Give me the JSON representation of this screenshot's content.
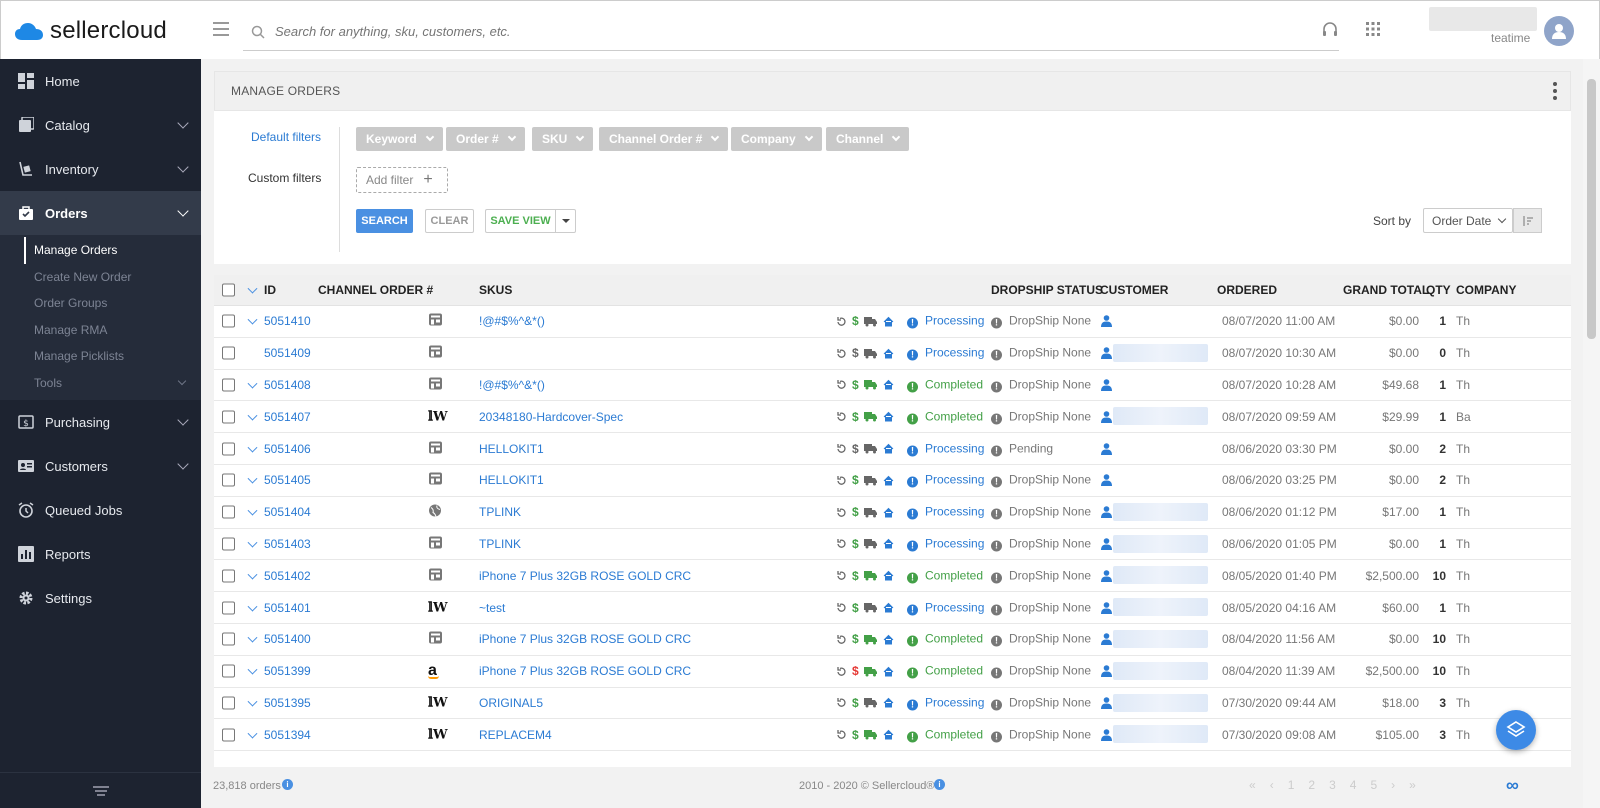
{
  "app": {
    "brand": "sellercloud",
    "brand_color": "#1e88e5"
  },
  "header": {
    "search_placeholder": "Search for anything, sku, customers, etc.",
    "username": "teatime",
    "icons": [
      "headset-icon",
      "apps-grid-icon",
      "avatar-icon"
    ]
  },
  "sidebar": {
    "items": [
      {
        "label": "Home",
        "icon": "dashboard-icon"
      },
      {
        "label": "Catalog",
        "icon": "catalog-icon"
      },
      {
        "label": "Inventory",
        "icon": "inventory-icon"
      },
      {
        "label": "Orders",
        "icon": "orders-icon"
      },
      {
        "label": "Purchasing",
        "icon": "purchasing-icon"
      },
      {
        "label": "Customers",
        "icon": "customers-icon"
      },
      {
        "label": "Queued Jobs",
        "icon": "clock-icon"
      },
      {
        "label": "Reports",
        "icon": "reports-icon"
      },
      {
        "label": "Settings",
        "icon": "gear-icon"
      }
    ],
    "orders_sub": [
      "Manage Orders",
      "Create New Order",
      "Order Groups",
      "Manage RMA",
      "Manage Picklists",
      "Tools"
    ]
  },
  "panel": {
    "title": "MANAGE ORDERS",
    "default_filters_label": "Default filters",
    "custom_filters_label": "Custom filters",
    "chips": [
      "Keyword",
      "Order #",
      "SKU",
      "Channel Order #",
      "Company",
      "Channel"
    ],
    "add_filter": "Add filter",
    "search_btn": "SEARCH",
    "clear_btn": "CLEAR",
    "save_view_btn": "SAVE VIEW",
    "sort_by_label": "Sort by",
    "sort_value": "Order Date"
  },
  "table": {
    "headers": {
      "id": "ID",
      "channel_order": "CHANNEL ORDER #",
      "skus": "SKUS",
      "dropship": "DROPSHIP STATUS",
      "customer": "CUSTOMER",
      "ordered": "ORDERED",
      "grand_total": "GRAND TOTAL",
      "qty": "QTY",
      "company": "COMPANY"
    },
    "rows": [
      {
        "id": "5051410",
        "channel": "store",
        "sku": "!@#$%^&*()",
        "status": "Processing",
        "dropship": "DropShip None",
        "ordered": "08/07/2020 11:00 AM",
        "total": "$0.00",
        "qty": "1",
        "company": "Th",
        "chev": true,
        "blur": false,
        "dollar": "green",
        "truck": "grey"
      },
      {
        "id": "5051409",
        "channel": "store",
        "sku": "",
        "status": "Processing",
        "dropship": "DropShip None",
        "ordered": "08/07/2020 10:30 AM",
        "total": "$0.00",
        "qty": "0",
        "company": "Th",
        "chev": false,
        "blur": true,
        "dollar": "grey",
        "truck": "grey"
      },
      {
        "id": "5051408",
        "channel": "store",
        "sku": "!@#$%^&*()",
        "status": "Completed",
        "dropship": "DropShip None",
        "ordered": "08/07/2020 10:28 AM",
        "total": "$49.68",
        "qty": "1",
        "company": "Th",
        "chev": true,
        "blur": false,
        "dollar": "green",
        "truck": "green"
      },
      {
        "id": "5051407",
        "channel": "bw",
        "sku": "20348180-Hardcover-Spec",
        "status": "Completed",
        "dropship": "DropShip None",
        "ordered": "08/07/2020 09:59 AM",
        "total": "$29.99",
        "qty": "1",
        "company": "Ba",
        "chev": true,
        "blur": true,
        "dollar": "green",
        "truck": "green"
      },
      {
        "id": "5051406",
        "channel": "store",
        "sku": "HELLOKIT1",
        "status": "Processing",
        "dropship": "Pending",
        "ordered": "08/06/2020 03:30 PM",
        "total": "$0.00",
        "qty": "2",
        "company": "Th",
        "chev": true,
        "blur": false,
        "dollar": "grey",
        "truck": "grey"
      },
      {
        "id": "5051405",
        "channel": "store",
        "sku": "HELLOKIT1",
        "status": "Processing",
        "dropship": "DropShip None",
        "ordered": "08/06/2020 03:25 PM",
        "total": "$0.00",
        "qty": "2",
        "company": "Th",
        "chev": true,
        "blur": false,
        "dollar": "green",
        "truck": "grey"
      },
      {
        "id": "5051404",
        "channel": "globe",
        "sku": "TPLINK",
        "status": "Processing",
        "dropship": "DropShip None",
        "ordered": "08/06/2020 01:12 PM",
        "total": "$17.00",
        "qty": "1",
        "company": "Th",
        "chev": true,
        "blur": true,
        "dollar": "green",
        "truck": "grey"
      },
      {
        "id": "5051403",
        "channel": "store",
        "sku": "TPLINK",
        "status": "Processing",
        "dropship": "DropShip None",
        "ordered": "08/06/2020 01:05 PM",
        "total": "$0.00",
        "qty": "1",
        "company": "Th",
        "chev": true,
        "blur": true,
        "dollar": "green",
        "truck": "grey"
      },
      {
        "id": "5051402",
        "channel": "store",
        "sku": "iPhone 7 Plus 32GB ROSE GOLD CRC",
        "status": "Completed",
        "dropship": "DropShip None",
        "ordered": "08/05/2020 01:40 PM",
        "total": "$2,500.00",
        "qty": "10",
        "company": "Th",
        "chev": true,
        "blur": true,
        "dollar": "green",
        "truck": "green"
      },
      {
        "id": "5051401",
        "channel": "bw",
        "sku": "~test",
        "status": "Processing",
        "dropship": "DropShip None",
        "ordered": "08/05/2020 04:16 AM",
        "total": "$60.00",
        "qty": "1",
        "company": "Th",
        "chev": true,
        "blur": true,
        "dollar": "green",
        "truck": "grey"
      },
      {
        "id": "5051400",
        "channel": "store",
        "sku": "iPhone 7 Plus 32GB ROSE GOLD CRC",
        "status": "Completed",
        "dropship": "DropShip None",
        "ordered": "08/04/2020 11:56 AM",
        "total": "$0.00",
        "qty": "10",
        "company": "Th",
        "chev": true,
        "blur": true,
        "dollar": "green",
        "truck": "green"
      },
      {
        "id": "5051399",
        "channel": "amazon",
        "sku": "iPhone 7 Plus 32GB ROSE GOLD CRC",
        "status": "Completed",
        "dropship": "DropShip None",
        "ordered": "08/04/2020 11:39 AM",
        "total": "$2,500.00",
        "qty": "10",
        "company": "Th",
        "chev": true,
        "blur": true,
        "dollar": "red",
        "truck": "green"
      },
      {
        "id": "5051395",
        "channel": "bw",
        "sku": "ORIGINAL5",
        "status": "Processing",
        "dropship": "DropShip None",
        "ordered": "07/30/2020 09:44 AM",
        "total": "$18.00",
        "qty": "3",
        "company": "Th",
        "chev": true,
        "blur": true,
        "dollar": "green",
        "truck": "grey"
      },
      {
        "id": "5051394",
        "channel": "bw",
        "sku": "REPLACEM4",
        "status": "Completed",
        "dropship": "DropShip None",
        "ordered": "07/30/2020 09:08 AM",
        "total": "$105.00",
        "qty": "3",
        "company": "Th",
        "chev": true,
        "blur": true,
        "dollar": "green",
        "truck": "green"
      }
    ]
  },
  "footer": {
    "count": "23,818 orders",
    "copyright": "2010 - 2020 © Sellercloud®",
    "pages": [
      "1",
      "2",
      "3",
      "4",
      "5"
    ]
  }
}
